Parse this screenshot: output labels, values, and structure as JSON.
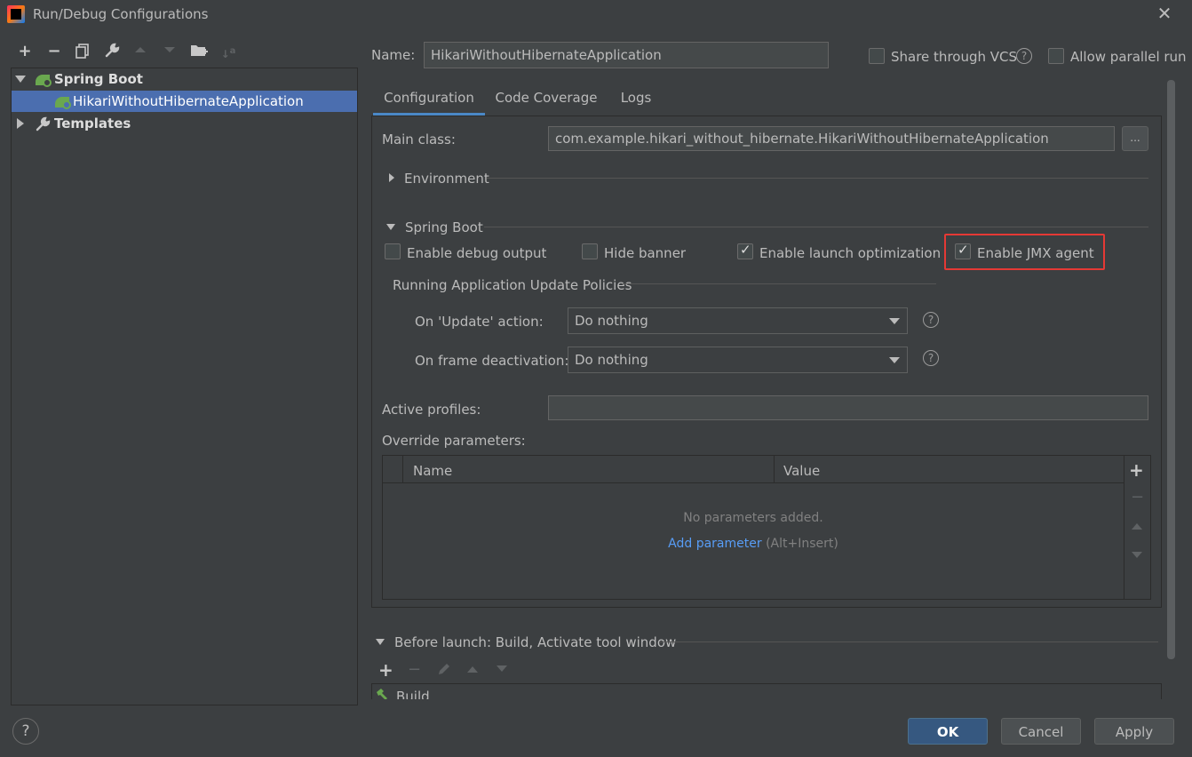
{
  "window": {
    "title": "Run/Debug Configurations",
    "close_label": "✕"
  },
  "toolbar": {
    "icons": [
      "add-icon",
      "remove-icon",
      "copy-icon",
      "wrench-icon",
      "move-up-icon",
      "move-down-icon",
      "new-folder-icon",
      "sort-icon"
    ]
  },
  "tree": {
    "spring_boot": "Spring Boot",
    "app": "HikariWithoutHibernateApplication",
    "templates": "Templates"
  },
  "header": {
    "name_label": "Name:",
    "name_value": "HikariWithoutHibernateApplication",
    "share_vcs": "Share through VCS",
    "allow_parallel": "Allow parallel run"
  },
  "tabs": [
    {
      "label": "Configuration",
      "active": true
    },
    {
      "label": "Code Coverage",
      "active": false
    },
    {
      "label": "Logs",
      "active": false
    }
  ],
  "config": {
    "main_class_label": "Main class:",
    "main_class_value": "com.example.hikari_without_hibernate.HikariWithoutHibernateApplication",
    "browse_label": "...",
    "environment": "Environment",
    "spring_boot_section": "Spring Boot",
    "enable_debug": "Enable debug output",
    "hide_banner": "Hide banner",
    "enable_launch_opt": "Enable launch optimization",
    "enable_jmx": "Enable JMX agent",
    "running_policies": "Running Application Update Policies",
    "on_update_label": "On 'Update' action:",
    "on_update_value": "Do nothing",
    "on_frame_label": "On frame deactivation:",
    "on_frame_value": "Do nothing",
    "active_profiles_label": "Active profiles:",
    "active_profiles_value": "",
    "override_label": "Override parameters:",
    "col_name": "Name",
    "col_value": "Value",
    "no_params": "No parameters added.",
    "add_param_link": "Add parameter",
    "add_param_hint": "(Alt+Insert)",
    "checks": {
      "enable_debug": false,
      "hide_banner": false,
      "enable_launch_opt": true,
      "enable_jmx": true
    }
  },
  "before_launch": {
    "title": "Before launch: Build, Activate tool window",
    "build_item": "Build"
  },
  "buttons": {
    "help": "?",
    "ok": "OK",
    "cancel": "Cancel",
    "apply": "Apply"
  },
  "colors": {
    "selection": "#4b6eaf",
    "accent": "#4a88c7",
    "link": "#589df6",
    "highlight": "#e53935",
    "ok_button": "#365880"
  }
}
